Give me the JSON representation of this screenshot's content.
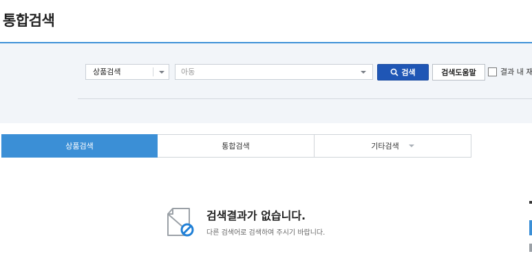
{
  "page": {
    "title": "통합검색"
  },
  "search": {
    "category_value": "상품검색",
    "keyword_value": "아동",
    "search_button_label": "검색",
    "help_button_label": "검색도움말",
    "recheck_label": "결과 내 재검"
  },
  "tabs": [
    {
      "label": "상품검색",
      "active": true
    },
    {
      "label": "통합검색",
      "active": false
    },
    {
      "label": "기타검색",
      "active": false
    }
  ],
  "empty_state": {
    "title": "검색결과가 없습니다.",
    "subtitle": "다른 검색어로 검색하여 주시기 바랍니다."
  },
  "colors": {
    "accent": "#3b8fd6",
    "search_button": "#1f56b5",
    "panel_bg": "#f2f5f9"
  },
  "icons": [
    "chevron-down-icon",
    "search-icon",
    "checkbox-icon",
    "no-results-icon"
  ]
}
